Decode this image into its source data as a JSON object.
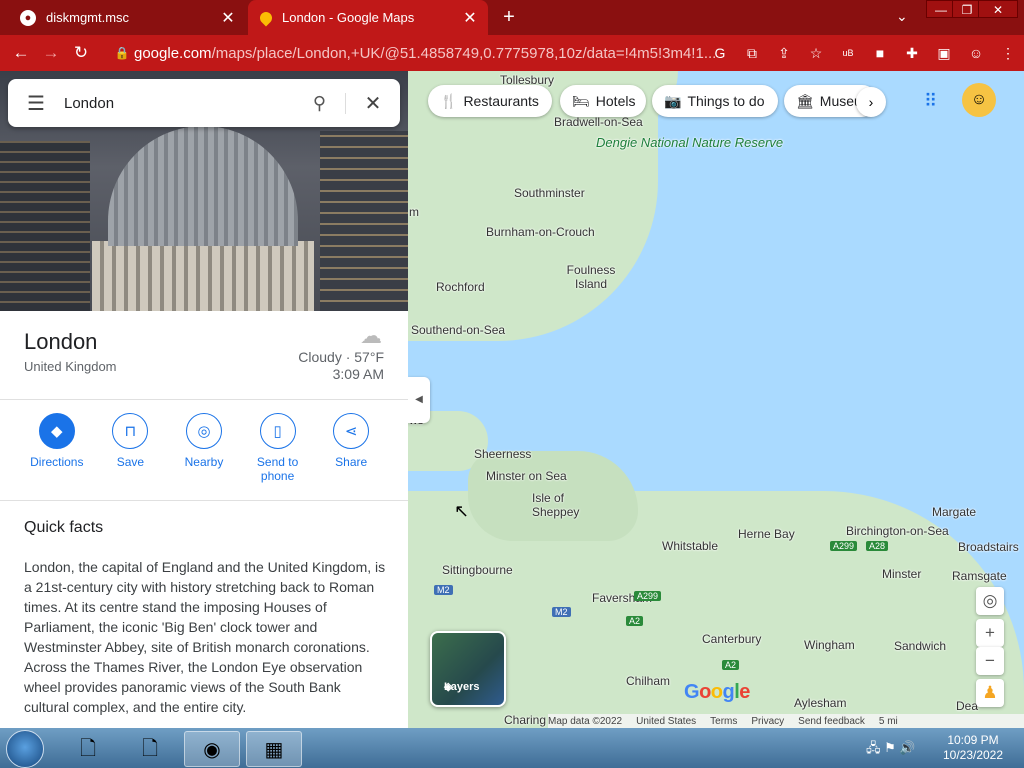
{
  "browser": {
    "tabs": [
      {
        "title": "diskmgmt.msc",
        "active": false
      },
      {
        "title": "London - Google Maps",
        "active": true
      }
    ],
    "url_host": "google.com",
    "url_path": "/maps/place/London,+UK/@51.4858749,0.7775978,10z/data=!4m5!3m4!1...",
    "accent_color": "#c01818"
  },
  "panel": {
    "search_value": "London",
    "place_title": "London",
    "place_subtitle": "United Kingdom",
    "weather": "Cloudy · 57°F",
    "local_time": "3:09 AM",
    "actions": [
      {
        "label": "Directions"
      },
      {
        "label": "Save"
      },
      {
        "label": "Nearby"
      },
      {
        "label": "Send to phone"
      },
      {
        "label": "Share"
      }
    ],
    "quick_facts_title": "Quick facts",
    "quick_facts_text": "London, the capital of England and the United Kingdom, is a 21st-century city with history stretching back to Roman times. At its centre stand the imposing Houses of Parliament, the iconic 'Big Ben' clock tower and Westminster Abbey, site of British monarch coronations. Across the Thames River, the London Eye observation wheel provides panoramic views of the South Bank cultural complex, and the entire city."
  },
  "map": {
    "chips": [
      {
        "label": "Restaurants",
        "icon": "fork-knife-icon"
      },
      {
        "label": "Hotels",
        "icon": "bed-icon"
      },
      {
        "label": "Things to do",
        "icon": "camera-icon"
      },
      {
        "label": "Museu",
        "icon": "museum-icon"
      }
    ],
    "places": {
      "tollesbury": "Tollesbury",
      "bradwell": "Bradwell-on-Sea",
      "dengie": "Dengie National Nature Reserve",
      "southminster": "Southminster",
      "burnham": "Burnham-on-Crouch",
      "foulness": "Foulness Island",
      "rochford": "Rochford",
      "southend": "Southend-on-Sea",
      "sheerness": "Sheerness",
      "minster_sea": "Minster on Sea",
      "sheppey": "Isle of Sheppey",
      "whitstable": "Whitstable",
      "herne_bay": "Herne Bay",
      "birchington": "Birchington-on-Sea",
      "margate": "Margate",
      "broadstairs": "Broadstairs",
      "sittingbourne": "Sittingbourne",
      "faversham": "Faversham",
      "minster": "Minster",
      "ramsgate": "Ramsgate",
      "canterbury": "Canterbury",
      "wingham": "Wingham",
      "sandwich": "Sandwich",
      "chilham": "Chilham",
      "aylesham": "Aylesham",
      "charing": "Charing",
      "deal": "Dea",
      "edge_m": "m",
      "edge_ws": "ws"
    },
    "roads": [
      "A299",
      "A28",
      "M2",
      "M2",
      "A299",
      "A2",
      "A2"
    ],
    "layers_label": "Layers",
    "google_logo": "Google",
    "footer": [
      "Map data ©2022",
      "United States",
      "Terms",
      "Privacy",
      "Send feedback",
      "5 mi"
    ]
  },
  "taskbar": {
    "time": "10:09 PM",
    "date": "10/23/2022"
  }
}
